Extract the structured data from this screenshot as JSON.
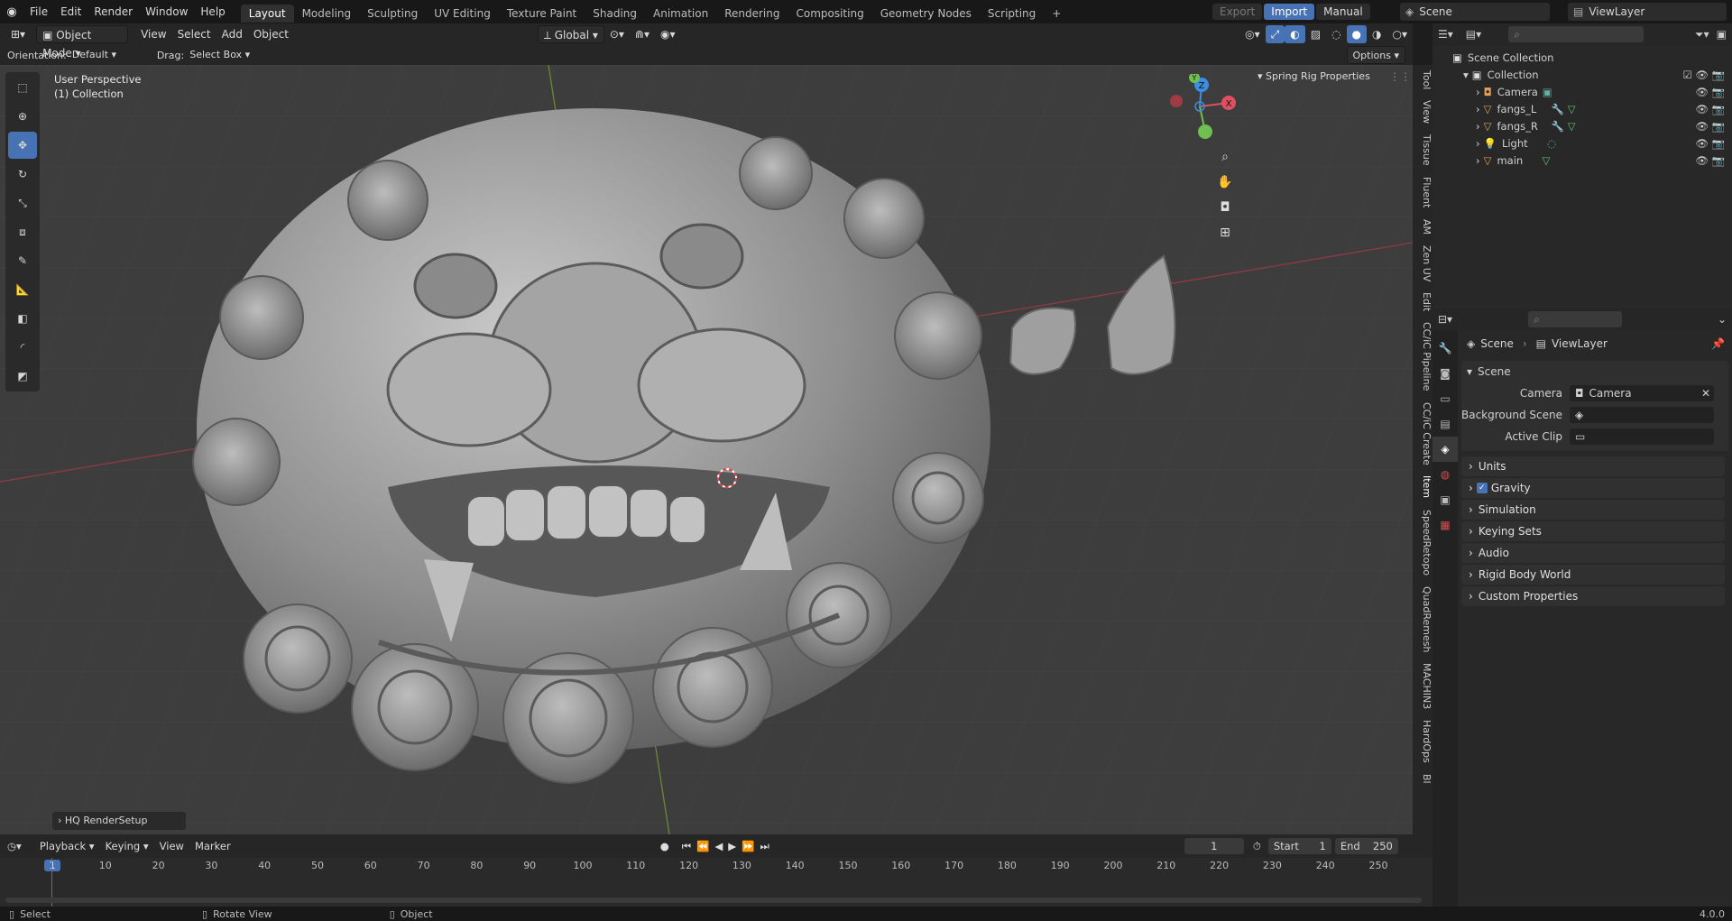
{
  "topbar": {
    "menus": [
      "File",
      "Edit",
      "Render",
      "Window",
      "Help"
    ],
    "workspaces": [
      "Layout",
      "Modeling",
      "Sculpting",
      "UV Editing",
      "Texture Paint",
      "Shading",
      "Animation",
      "Rendering",
      "Compositing",
      "Geometry Nodes",
      "Scripting"
    ],
    "active_workspace": "Layout",
    "export_label": "Export",
    "import_label": "Import",
    "manual_label": "Manual",
    "scene_label": "Scene",
    "viewlayer_label": "ViewLayer"
  },
  "viewport_header": {
    "mode": "Object Mode",
    "menus": [
      "View",
      "Select",
      "Add",
      "Object"
    ],
    "transform_orientation": "Global",
    "orientation_label": "Orientation:",
    "orientation_value": "Default",
    "drag_label": "Drag:",
    "drag_value": "Select Box",
    "options_label": "Options"
  },
  "viewport": {
    "perspective": "User Perspective",
    "collection": "(1) Collection",
    "spring_rig": "Spring Rig Properties",
    "hq_render": "HQ RenderSetup",
    "gizmo": {
      "x": "X",
      "y": "Y",
      "z": "Z",
      "x_color": "#e04f5f",
      "y_color": "#6ec050",
      "z_color": "#3c8ee0"
    }
  },
  "right_tabs": [
    "Tool",
    "View",
    "Tissue",
    "Fluent",
    "AM",
    "Zen UV",
    "Edit",
    "CC/iC Pipeline",
    "CC/iC Create",
    "Item",
    "SpeedRetopo",
    "QuadRemesh",
    "MACHIN3",
    "HardOps",
    "Bl"
  ],
  "outliner": {
    "root": "Scene Collection",
    "collection": "Collection",
    "items": [
      {
        "name": "Camera",
        "icon": "camera-icon"
      },
      {
        "name": "fangs_L",
        "icon": "mesh-icon"
      },
      {
        "name": "fangs_R",
        "icon": "mesh-icon"
      },
      {
        "name": "Light",
        "icon": "light-icon"
      },
      {
        "name": "main",
        "icon": "mesh-icon"
      }
    ]
  },
  "properties": {
    "breadcrumb_scene": "Scene",
    "breadcrumb_viewlayer": "ViewLayer",
    "section": "Scene",
    "camera_label": "Camera",
    "camera_value": "Camera",
    "background_label": "Background Scene",
    "active_clip_label": "Active Clip",
    "panels": [
      "Units",
      "Gravity",
      "Simulation",
      "Keying Sets",
      "Audio",
      "Rigid Body World",
      "Custom Properties"
    ]
  },
  "timeline": {
    "menus": [
      "Playback",
      "Keying",
      "View",
      "Marker"
    ],
    "current_frame": "1",
    "start_label": "Start",
    "start_value": "1",
    "end_label": "End",
    "end_value": "250",
    "ticks": [
      "1",
      "10",
      "20",
      "30",
      "40",
      "50",
      "60",
      "70",
      "80",
      "90",
      "100",
      "110",
      "120",
      "130",
      "140",
      "150",
      "160",
      "170",
      "180",
      "190",
      "200",
      "210",
      "220",
      "230",
      "240",
      "250"
    ]
  },
  "statusbar": {
    "select": "Select",
    "rotate": "Rotate View",
    "object": "Object",
    "version": "4.0.0"
  }
}
